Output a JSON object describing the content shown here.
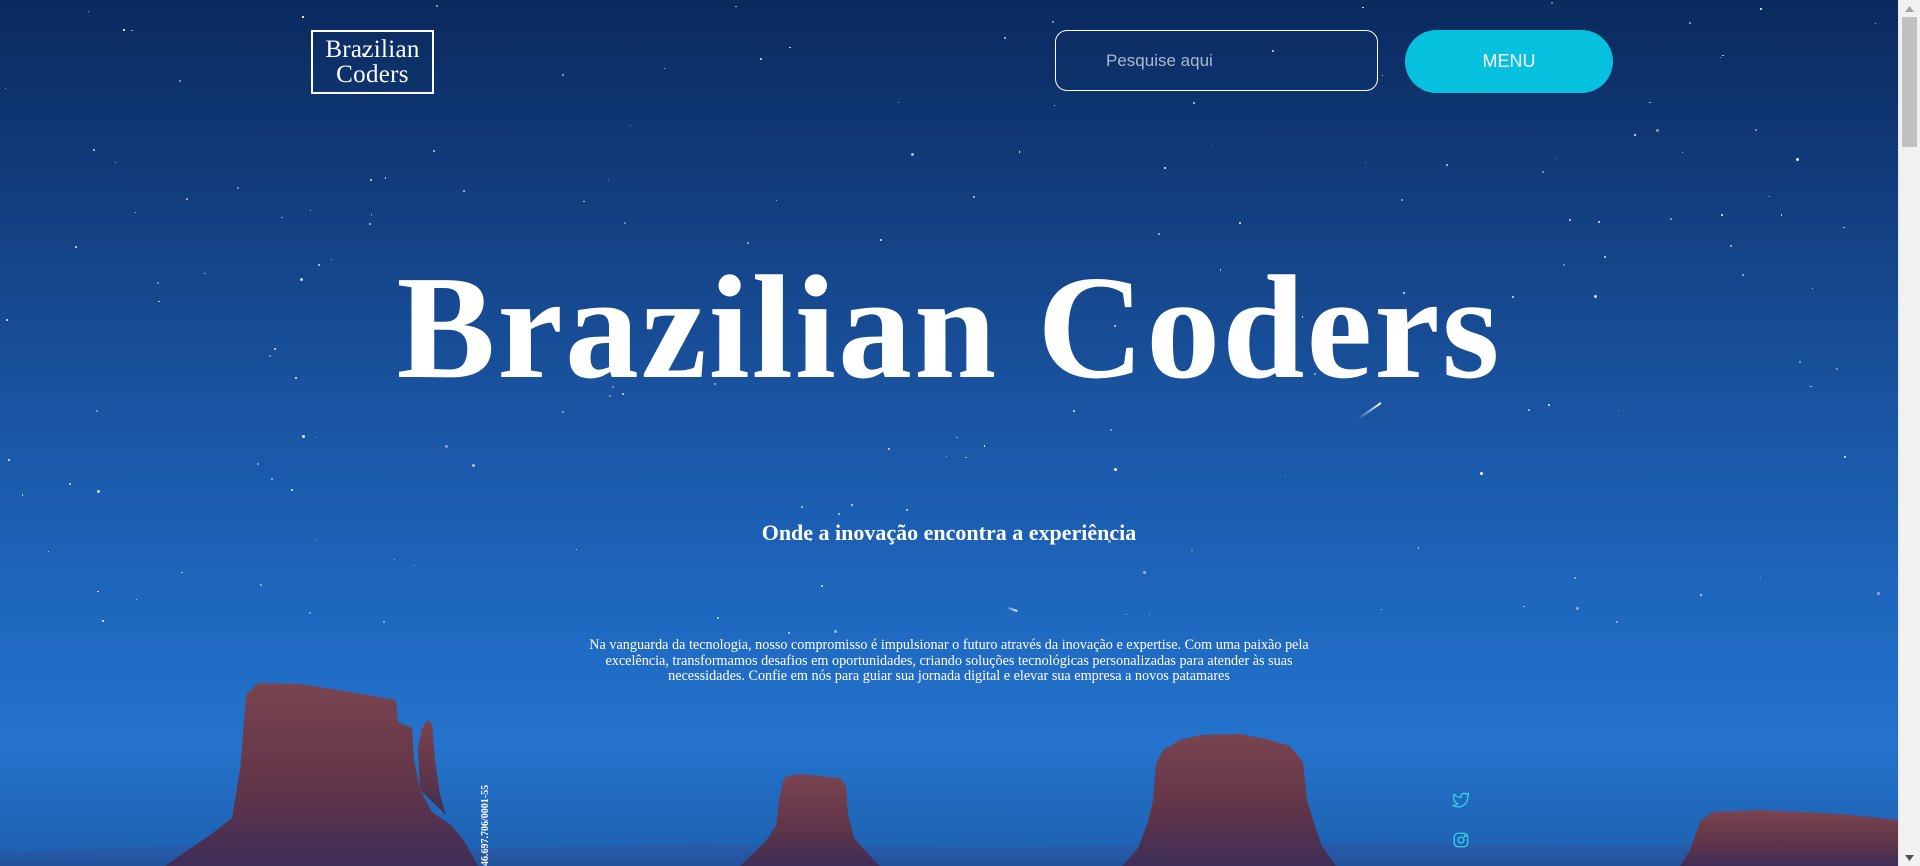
{
  "header": {
    "logo_line1": "Brazilian",
    "logo_line2": "Coders",
    "search_placeholder": "Pesquise aqui",
    "menu_label": "MENU"
  },
  "hero": {
    "title": "Brazilian Coders",
    "subtitle": "Onde a inovação encontra a experiência",
    "description": "Na vanguarda da tecnologia, nosso compromisso é impulsionar o futuro através da inovação e expertise. Com uma paixão pela excelência, transformamos desafios em oportunidades, criando soluções tecnológicas personalizadas para atender às suas necessidades. Confie em nós para guiar sua jornada digital e elevar sua empresa a novos patamares",
    "vertical_text": "46.697.706/0001-55"
  },
  "social": {
    "twitter_icon": "twitter-icon",
    "instagram_icon": "instagram-icon",
    "icon_color": "#2fd3e6"
  },
  "colors": {
    "accent": "#05c1dd",
    "sky_top": "#0a2a5e",
    "sky_bottom": "#2473cc",
    "rock": "#6a3a48"
  }
}
